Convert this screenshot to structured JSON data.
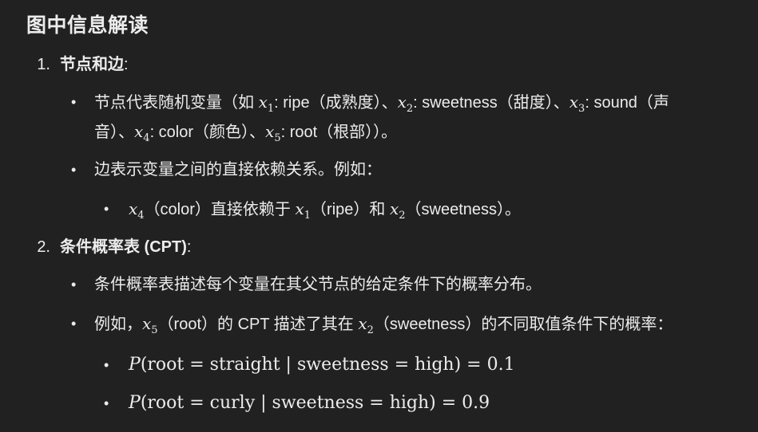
{
  "title": "图中信息解读",
  "s1": {
    "num": "1.",
    "heading": "节点和边",
    "colon": ":",
    "b1": {
      "a": "节点代表随机变量（如 ",
      "x1": "x",
      "x1s": "1",
      "t1": ": ripe（成熟度）、",
      "x2": "x",
      "x2s": "2",
      "t2": ": sweetness（甜度）、",
      "x3": "x",
      "x3s": "3",
      "t3": ": sound（声",
      "l2a": "音）、",
      "x4": "x",
      "x4s": "4",
      "t4": ": color（颜色）、",
      "x5": "x",
      "x5s": "5",
      "t5": ": root（根部））。"
    },
    "b2": "边表示变量之间的直接依赖关系。例如：",
    "b3": {
      "x4": "x",
      "x4s": "4",
      "t1": "（color）直接依赖于 ",
      "x1": "x",
      "x1s": "1",
      "t2": "（ripe）和 ",
      "x2": "x",
      "x2s": "2",
      "t3": "（sweetness）。"
    }
  },
  "s2": {
    "num": "2.",
    "heading": "条件概率表 (CPT)",
    "colon": ":",
    "b1": "条件概率表描述每个变量在其父节点的给定条件下的概率分布。",
    "b2": {
      "a": "例如，",
      "x5": "x",
      "x5s": "5",
      "t1": "（root）的 CPT 描述了其在 ",
      "x2": "x",
      "x2s": "2",
      "t2": "（sweetness）的不同取值条件下的概率："
    },
    "f1": {
      "p": "P",
      "body": "(root = straight | sweetness = high) = 0.1"
    },
    "f2": {
      "p": "P",
      "body": "(root = curly | sweetness = high) = 0.9"
    }
  }
}
